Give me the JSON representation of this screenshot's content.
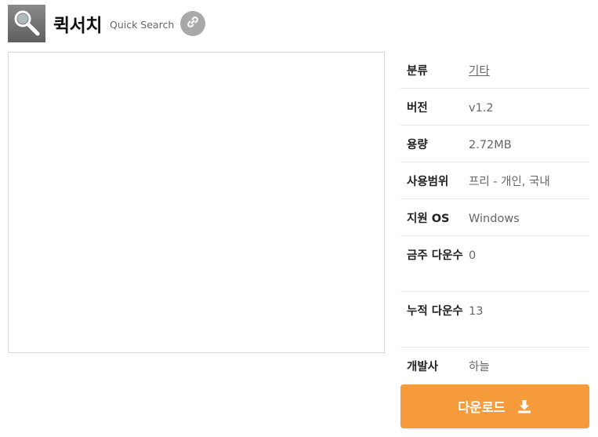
{
  "app": {
    "title": "퀵서치",
    "subtitle": "Quick Search",
    "icon": "magnifier-icon",
    "link_icon": "link-icon"
  },
  "info": {
    "rows": [
      {
        "label": "분류",
        "value": "기타"
      },
      {
        "label": "버전",
        "value": "v1.2"
      },
      {
        "label": "용량",
        "value": "2.72MB"
      },
      {
        "label": "사용범위",
        "value": "프리 - 개인, 국내"
      },
      {
        "label": "지원 OS",
        "value": "Windows"
      },
      {
        "label": "금주 다운수",
        "value": "0"
      },
      {
        "label": "누적 다운수",
        "value": "13"
      },
      {
        "label": "개발사",
        "value": "하늘"
      }
    ]
  },
  "download": {
    "label": "다운로드",
    "icon": "download-icon"
  },
  "colors": {
    "accent": "#f59b3b",
    "link_button_bg": "#a9a9a9",
    "icon_bg": "#6f6f6f"
  }
}
